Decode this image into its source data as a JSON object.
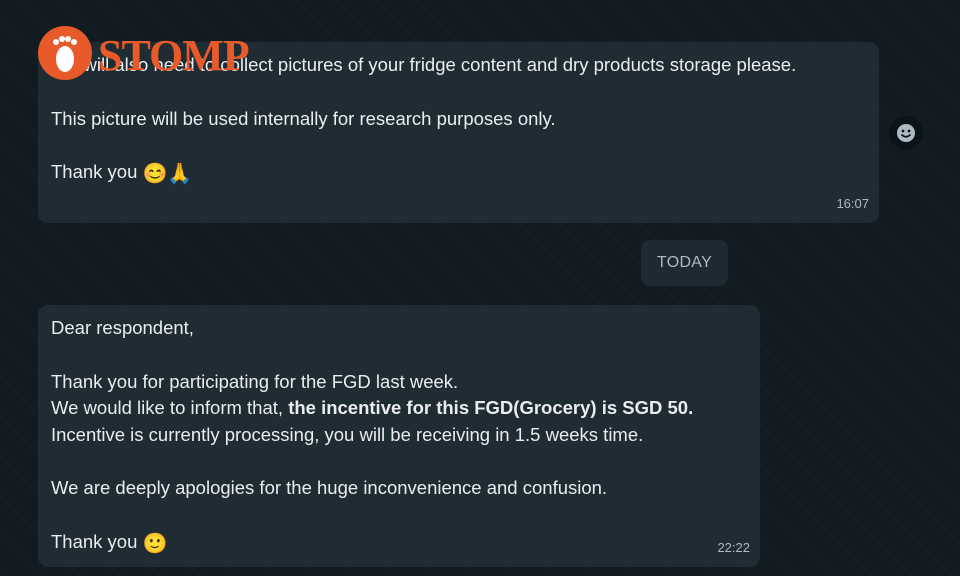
{
  "watermark": {
    "brand": "STOMP",
    "color": "#e85a2a"
  },
  "messages": [
    {
      "id": "msg1",
      "lines": [
        "We will also need to collect pictures of your fridge content and dry products storage please.",
        "",
        "This picture will be used internally for research purposes only.",
        "",
        "Thank you"
      ],
      "closing_emojis": "😊🙏",
      "time": "16:07"
    },
    {
      "id": "msg2",
      "greeting": "Dear respondent,",
      "line_thanks": "Thank you for participating for the FGD last week.",
      "line_inform_prefix": "We would like to inform that, ",
      "line_inform_bold": "the incentive for this FGD(Grocery) is SGD 50.",
      "line_processing": "Incentive is currently processing, you will be receiving in 1.5 weeks time.",
      "line_apology": "We are deeply apologies for the huge inconvenience and confusion.",
      "closing": "Thank you",
      "closing_emoji": "🙂",
      "time": "22:22"
    }
  ],
  "date_divider": "TODAY",
  "icons": {
    "reaction": "smiley-face-icon"
  },
  "colors": {
    "bubble": "#202c33",
    "background": "#111b21",
    "meta_text": "#aebac1"
  }
}
